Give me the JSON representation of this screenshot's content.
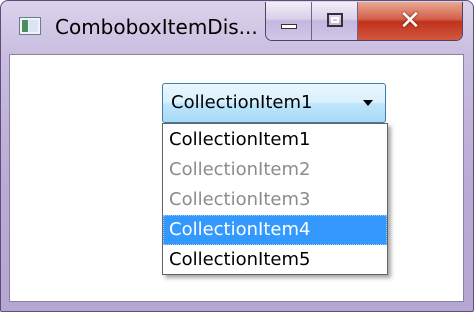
{
  "window": {
    "title": "ComboboxItemDis...",
    "icon": "app-window-icon",
    "controls": {
      "minimize": "minimize-icon",
      "maximize": "maximize-icon",
      "close": "close-icon",
      "close_glyph": "✕"
    }
  },
  "combobox": {
    "selected_value": "CollectionItem1",
    "arrow_icon": "dropdown-arrow-icon",
    "items": [
      {
        "label": "CollectionItem1",
        "enabled": true,
        "highlighted": false
      },
      {
        "label": "CollectionItem2",
        "enabled": false,
        "highlighted": false
      },
      {
        "label": "CollectionItem3",
        "enabled": false,
        "highlighted": false
      },
      {
        "label": "CollectionItem4",
        "enabled": true,
        "highlighted": true
      },
      {
        "label": "CollectionItem5",
        "enabled": true,
        "highlighted": false
      }
    ]
  },
  "colors": {
    "highlight": "#3399ff",
    "disabled_text": "#8c8c8c",
    "close_button": "#c0321c"
  }
}
